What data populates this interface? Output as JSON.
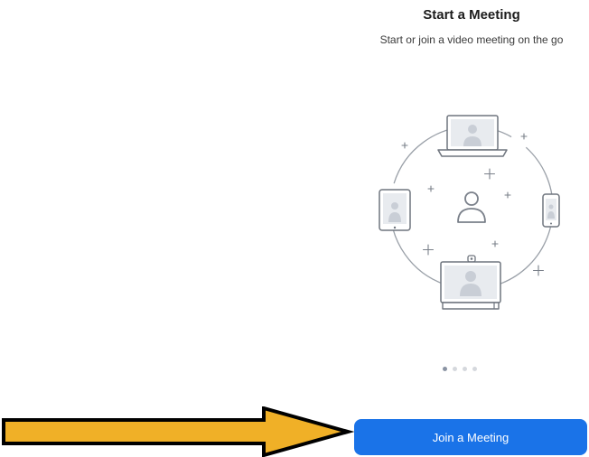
{
  "header": {
    "title": "Start a Meeting",
    "subtitle": "Start or join a video meeting on the go"
  },
  "illustration": {
    "icon": "video-meeting-devices-illustration"
  },
  "pagination": {
    "count": 4,
    "active_index": 0
  },
  "actions": {
    "join_label": "Join a Meeting"
  },
  "annotation": {
    "icon": "arrow-right-icon",
    "color": "#f0b027"
  },
  "colors": {
    "accent": "#1a73e8"
  }
}
